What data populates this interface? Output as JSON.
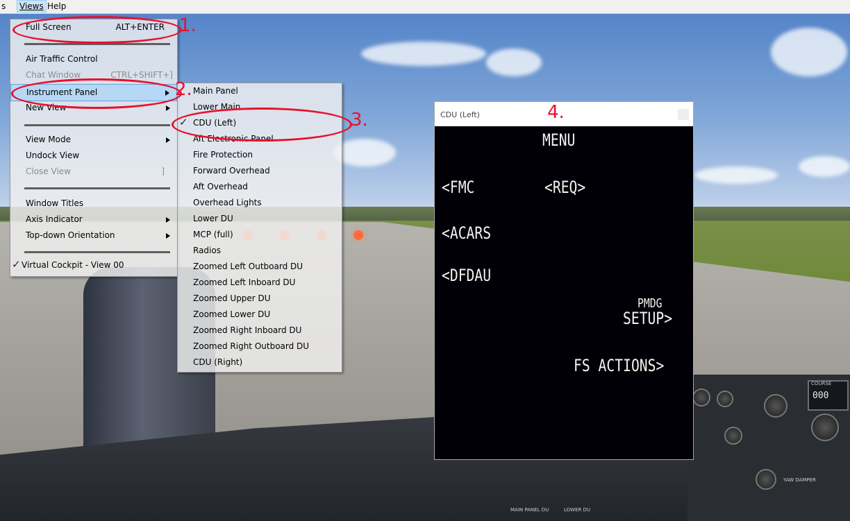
{
  "menubar": {
    "items": [
      "s",
      "Views",
      "Help"
    ]
  },
  "views_menu": {
    "full_screen": "Full Screen",
    "full_screen_shortcut": "ALT+ENTER",
    "air_traffic_control": "Air Traffic Control",
    "chat_window": "Chat Window",
    "chat_window_shortcut": "CTRL+SHIFT+]",
    "instrument_panel": "Instrument Panel",
    "new_view": "New View",
    "view_mode": "View Mode",
    "undock_view": "Undock View",
    "close_view": "Close View",
    "close_view_shortcut": "]",
    "window_titles": "Window Titles",
    "axis_indicator": "Axis Indicator",
    "top_down_orientation": "Top-down Orientation",
    "virtual_cockpit": "Virtual Cockpit - View 00"
  },
  "instrument_menu": {
    "items": [
      "Main Panel",
      "Lower Main",
      "CDU (Left)",
      "Aft Electronic Panel",
      "Fire Protection",
      "Forward Overhead",
      "Aft Overhead",
      "Overhead Lights",
      "Lower DU",
      "MCP (full)",
      "Radios",
      "Zoomed Left Outboard DU",
      "Zoomed Left Inboard DU",
      "Zoomed Upper DU",
      "Zoomed Lower DU",
      "Zoomed Right Inboard DU",
      "Zoomed Right Outboard DU",
      "CDU (Right)"
    ],
    "checked_index": 2
  },
  "annotations": [
    "1.",
    "2.",
    "3.",
    "4."
  ],
  "colors": {
    "annotation": "#e8102c"
  },
  "cdu": {
    "window_title": "CDU (Left)",
    "screen": {
      "title": "MENU",
      "fmc": "<FMC",
      "req": "<REQ>",
      "acars": "<ACARS",
      "dfdau": "<DFDAU",
      "pmdg": "PMDG",
      "setup": "SETUP>",
      "fs_actions": "FS ACTIONS>"
    }
  },
  "cockpit_panel": {
    "course_label": "COURSE",
    "course_value": "000",
    "main_panel_du": "MAIN PANEL DU",
    "lower_du": "LOWER DU",
    "yaw_damper": "YAW DAMPER"
  }
}
